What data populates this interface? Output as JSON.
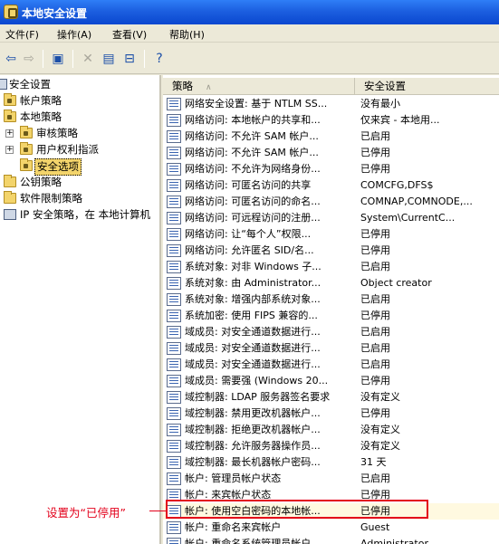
{
  "window": {
    "title": "本地安全设置"
  },
  "menu": [
    "文件(F)",
    "操作(A)",
    "查看(V)",
    "帮助(H)"
  ],
  "toolbar": [
    "back-icon",
    "forward-icon",
    "up-folder-icon",
    "delete-icon",
    "properties-icon",
    "export-icon",
    "help-icon"
  ],
  "tree": [
    {
      "label": "安全设置",
      "icon": "computer-icon",
      "level": 0
    },
    {
      "label": "帐户策略",
      "icon": "folder-lock-icon",
      "level": 1
    },
    {
      "label": "本地策略",
      "icon": "folder-lock-icon",
      "level": 1
    },
    {
      "label": "审核策略",
      "icon": "folder-icon",
      "level": 2,
      "expander": "+"
    },
    {
      "label": "用户权利指派",
      "icon": "folder-icon",
      "level": 2,
      "expander": "+"
    },
    {
      "label": "安全选项",
      "icon": "folder-icon",
      "level": 2,
      "selected": true
    },
    {
      "label": "公钥策略",
      "icon": "folder-icon",
      "level": 1
    },
    {
      "label": "软件限制策略",
      "icon": "folder-icon",
      "level": 1
    },
    {
      "label": "IP 安全策略，在 本地计算机",
      "icon": "computer-icon",
      "level": 1
    }
  ],
  "list": {
    "columns": [
      "策略",
      "安全设置"
    ],
    "rows": [
      {
        "policy": "网络安全设置: 基于 NTLM SS...",
        "setting": "没有最小"
      },
      {
        "policy": "网络访问: 本地帐户的共享和...",
        "setting": "仅来宾 - 本地用..."
      },
      {
        "policy": "网络访问: 不允许 SAM 帐户...",
        "setting": "已启用"
      },
      {
        "policy": "网络访问: 不允许 SAM 帐户...",
        "setting": "已停用"
      },
      {
        "policy": "网络访问: 不允许为网络身份...",
        "setting": "已停用"
      },
      {
        "policy": "网络访问: 可匿名访问的共享",
        "setting": "COMCFG,DFS$"
      },
      {
        "policy": "网络访问: 可匿名访问的命名...",
        "setting": "COMNAP,COMNODE,..."
      },
      {
        "policy": "网络访问: 可远程访问的注册...",
        "setting": "System\\CurrentC..."
      },
      {
        "policy": "网络访问: 让“每个人”权限...",
        "setting": "已停用"
      },
      {
        "policy": "网络访问: 允许匿名 SID/名...",
        "setting": "已停用"
      },
      {
        "policy": "系统对象: 对非 Windows 子...",
        "setting": "已启用"
      },
      {
        "policy": "系统对象: 由 Administrator...",
        "setting": "Object creator"
      },
      {
        "policy": "系统对象: 增强内部系统对象...",
        "setting": "已启用"
      },
      {
        "policy": "系统加密: 使用 FIPS 兼容的...",
        "setting": "已停用"
      },
      {
        "policy": "域成员: 对安全通道数据进行...",
        "setting": "已启用"
      },
      {
        "policy": "域成员: 对安全通道数据进行...",
        "setting": "已启用"
      },
      {
        "policy": "域成员: 对安全通道数据进行...",
        "setting": "已启用"
      },
      {
        "policy": "域成员: 需要强 (Windows 20...",
        "setting": "已停用"
      },
      {
        "policy": "域控制器: LDAP 服务器签名要求",
        "setting": "没有定义"
      },
      {
        "policy": "域控制器: 禁用更改机器帐户...",
        "setting": "已停用"
      },
      {
        "policy": "域控制器: 拒绝更改机器帐户...",
        "setting": "没有定义"
      },
      {
        "policy": "域控制器: 允许服务器操作员...",
        "setting": "没有定义"
      },
      {
        "policy": "域控制器: 最长机器帐户密码...",
        "setting": "31 天"
      },
      {
        "policy": "帐户: 管理员帐户状态",
        "setting": "已启用"
      },
      {
        "policy": "帐户: 来宾帐户状态",
        "setting": "已停用"
      },
      {
        "policy": "帐户: 使用空白密码的本地帐...",
        "setting": "已停用",
        "highlighted": true
      },
      {
        "policy": "帐户: 重命名来宾帐户",
        "setting": "Guest"
      },
      {
        "policy": "帐户: 重命名系统管理员帐户",
        "setting": "Administrator"
      }
    ]
  },
  "annotation": {
    "text": "设置为“已停用”",
    "color": "#e3001b"
  }
}
